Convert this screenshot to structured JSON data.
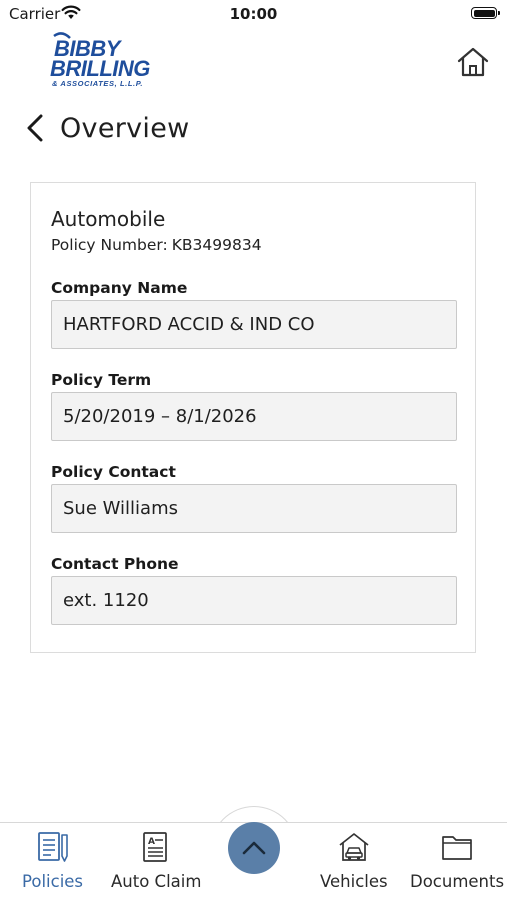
{
  "status_bar": {
    "carrier": "Carrier",
    "time": "10:00"
  },
  "header": {
    "logo": {
      "line1": "BIBBY",
      "line2": "BRILLING",
      "line3": "& ASSOCIATES, L.L.P."
    },
    "home_icon": "home-icon"
  },
  "nav": {
    "title": "Overview",
    "back_icon": "chevron-left-icon"
  },
  "policy": {
    "type": "Automobile",
    "number_label": "Policy Number:",
    "number": "KB3499834",
    "fields": [
      {
        "label": "Company Name",
        "value": "HARTFORD ACCID & IND CO"
      },
      {
        "label": "Policy Term",
        "value": "5/20/2019 – 8/1/2026"
      },
      {
        "label": "Policy Contact",
        "value": "Sue Williams"
      },
      {
        "label": "Contact Phone",
        "value": "ext. 1120"
      }
    ]
  },
  "tabbar": {
    "tabs": [
      {
        "label": "Policies",
        "icon": "policy-document-icon",
        "active": true
      },
      {
        "label": "Auto Claim",
        "icon": "claim-form-icon",
        "active": false
      },
      {
        "label": "Vehicles",
        "icon": "garage-car-icon",
        "active": false
      },
      {
        "label": "Documents",
        "icon": "folder-icon",
        "active": false
      }
    ],
    "center_button_icon": "chevron-up-icon"
  },
  "colors": {
    "accent": "#3a6aa6",
    "logo_blue": "#1f4e9c",
    "fab": "#5a7fa8",
    "field_bg": "#f3f3f3"
  }
}
